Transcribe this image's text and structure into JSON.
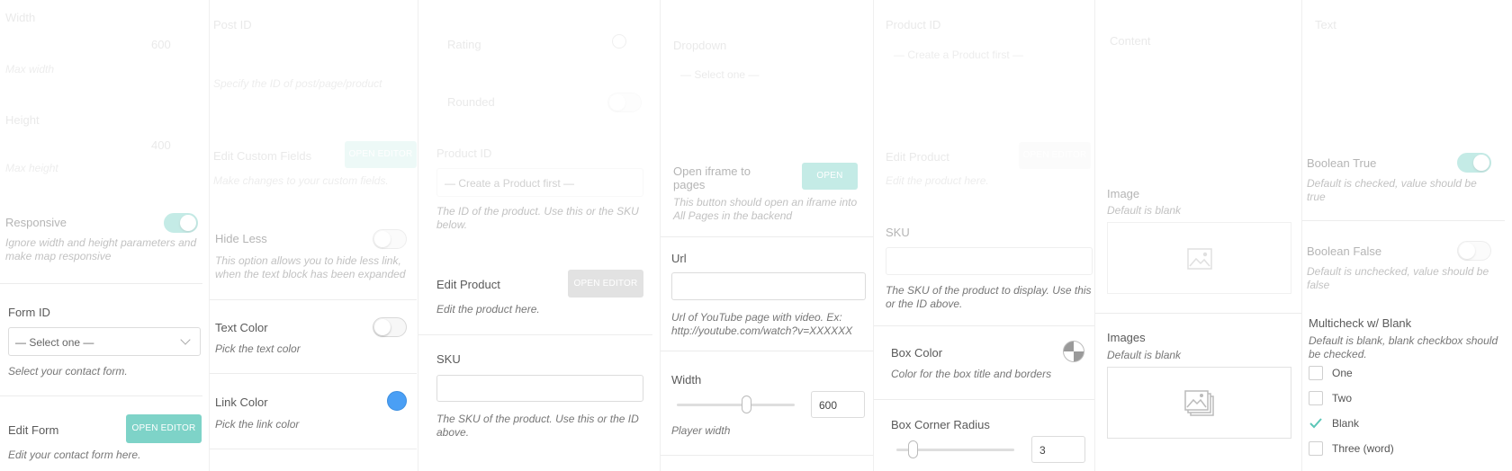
{
  "col1": {
    "width_label": "Width",
    "width_value": "600",
    "max_width_label": "Max width",
    "height_label": "Height",
    "height_value": "400",
    "max_height_label": "Max height",
    "responsive_label": "Responsive",
    "responsive_desc": "Ignore width and height parameters and make map responsive",
    "form_id_label": "Form ID",
    "form_id_value": "— Select one —",
    "form_id_desc": "Select your contact form.",
    "edit_form_label": "Edit Form",
    "edit_form_button": "OPEN EDITOR",
    "edit_form_desc": "Edit your contact form here."
  },
  "col2": {
    "post_id_label": "Post ID",
    "post_id_desc": "Specify the ID of post/page/product",
    "edit_custom_fields_label": "Edit Custom Fields",
    "edit_custom_fields_button": "OPEN EDITOR",
    "edit_custom_fields_desc": "Make changes to your custom fields.",
    "hide_less_label": "Hide Less",
    "hide_less_desc": "This option allows you to hide less link, when the text block has been expanded",
    "text_color_label": "Text Color",
    "text_color_desc": "Pick the text color",
    "link_color_label": "Link Color",
    "link_color_desc": "Pick the link color",
    "link_color_value": "#4a9ff5"
  },
  "col3": {
    "rating_label": "Rating",
    "rounded_label": "Rounded",
    "product_id_label": "Product ID",
    "product_id_value": "— Create a Product first —",
    "product_id_desc": "The ID of the product. Use this or the SKU below.",
    "edit_product_label": "Edit Product",
    "edit_product_button": "OPEN EDITOR",
    "edit_product_desc": "Edit the product here.",
    "sku_label": "SKU",
    "sku_desc": "The SKU of the product. Use this or the ID above."
  },
  "col4": {
    "dropdown_label": "Dropdown",
    "dropdown_value": "— Select one —",
    "open_iframe_label": "Open iframe to pages",
    "open_iframe_button": "OPEN",
    "open_iframe_desc": "This button should open an iframe into All Pages in the backend",
    "url_label": "Url",
    "url_desc": "Url of YouTube page with video. Ex: http://youtube.com/watch?v=XXXXXX",
    "width_label": "Width",
    "width_value": "600",
    "width_desc": "Player width"
  },
  "col5": {
    "product_id_label": "Product ID",
    "product_id_value": "— Create a Product first —",
    "edit_product_label": "Edit Product",
    "edit_product_button": "OPEN EDITOR",
    "edit_product_desc": "Edit the product here.",
    "sku_label": "SKU",
    "sku_desc": "The SKU of the product to display. Use this or the ID above.",
    "box_color_label": "Box Color",
    "box_color_desc": "Color for the box title and borders",
    "box_corner_radius_label": "Box Corner Radius",
    "box_corner_radius_value": "3"
  },
  "col6": {
    "content_label": "Content",
    "image_label": "Image",
    "image_desc": "Default is blank",
    "images_label": "Images",
    "images_desc": "Default is blank"
  },
  "col7": {
    "text_label": "Text",
    "boolean_true_label": "Boolean True",
    "boolean_true_desc": "Default is checked, value should be true",
    "boolean_false_label": "Boolean False",
    "boolean_false_desc": "Default is unchecked, value should be false",
    "multicheck_label": "Multicheck w/ Blank",
    "multicheck_desc": "Default is blank, blank checkbox should be checked.",
    "options": [
      {
        "label": "One",
        "checked": false
      },
      {
        "label": "Two",
        "checked": false
      },
      {
        "label": "Blank",
        "checked": true
      },
      {
        "label": "Three (word)",
        "checked": false
      }
    ]
  },
  "colors": {
    "accent": "#7ed3c8",
    "check": "#5cc6b8"
  }
}
